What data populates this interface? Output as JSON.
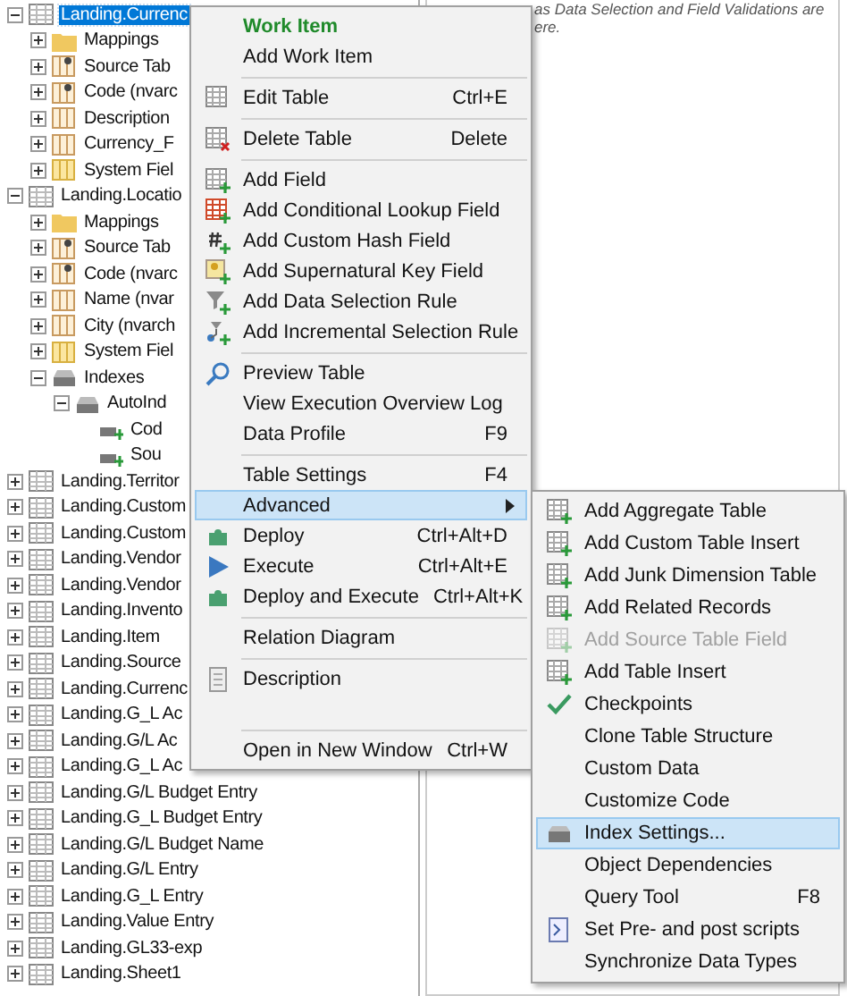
{
  "tree": {
    "items": [
      {
        "label": "Landing.Currenc",
        "kind": "table",
        "expanded": true,
        "selected": true,
        "children": [
          {
            "label": "Mappings",
            "kind": "folder",
            "expanded": false,
            "selected": false
          },
          {
            "label": "Source Tab",
            "kind": "key-field",
            "expanded": false,
            "selected": false
          },
          {
            "label": "Code (nvarc",
            "kind": "key-field",
            "expanded": false,
            "selected": false
          },
          {
            "label": "Description",
            "kind": "field",
            "expanded": false,
            "selected": false
          },
          {
            "label": "Currency_F",
            "kind": "field",
            "expanded": false,
            "selected": false
          },
          {
            "label": "System Fiel",
            "kind": "system-field",
            "expanded": false,
            "selected": false
          }
        ]
      },
      {
        "label": "Landing.Locatio",
        "kind": "table",
        "expanded": true,
        "selected": false,
        "children": [
          {
            "label": "Mappings",
            "kind": "folder",
            "expanded": false,
            "selected": false
          },
          {
            "label": "Source Tab",
            "kind": "key-field",
            "expanded": false,
            "selected": false
          },
          {
            "label": "Code (nvarc",
            "kind": "key-field",
            "expanded": false,
            "selected": false
          },
          {
            "label": "Name (nvar",
            "kind": "field",
            "expanded": false,
            "selected": false
          },
          {
            "label": "City (nvarch",
            "kind": "field",
            "expanded": false,
            "selected": false
          },
          {
            "label": "System Fiel",
            "kind": "system-field",
            "expanded": false,
            "selected": false
          },
          {
            "label": "Indexes",
            "kind": "indexes",
            "expanded": true,
            "selected": false,
            "children": [
              {
                "label": "AutoInd",
                "kind": "indexes",
                "expanded": true,
                "selected": false,
                "children": [
                  {
                    "label": "Cod",
                    "kind": "index",
                    "selected": false
                  },
                  {
                    "label": "Sou",
                    "kind": "index",
                    "selected": false
                  }
                ]
              }
            ]
          }
        ]
      },
      {
        "label": "Landing.Territor",
        "kind": "table",
        "expanded": false,
        "selected": false
      },
      {
        "label": "Landing.Custom",
        "kind": "table",
        "expanded": false,
        "selected": false
      },
      {
        "label": "Landing.Custom",
        "kind": "table",
        "expanded": false,
        "selected": false
      },
      {
        "label": "Landing.Vendor",
        "kind": "table",
        "expanded": false,
        "selected": false
      },
      {
        "label": "Landing.Vendor",
        "kind": "table",
        "expanded": false,
        "selected": false
      },
      {
        "label": "Landing.Invento",
        "kind": "table",
        "expanded": false,
        "selected": false
      },
      {
        "label": "Landing.Item",
        "kind": "table",
        "expanded": false,
        "selected": false
      },
      {
        "label": "Landing.Source",
        "kind": "table",
        "expanded": false,
        "selected": false
      },
      {
        "label": "Landing.Currenc",
        "kind": "table",
        "expanded": false,
        "selected": false
      },
      {
        "label": "Landing.G_L Ac",
        "kind": "table",
        "expanded": false,
        "selected": false
      },
      {
        "label": "Landing.G/L Ac",
        "kind": "table",
        "expanded": false,
        "selected": false
      },
      {
        "label": "Landing.G_L Ac",
        "kind": "table",
        "expanded": false,
        "selected": false
      },
      {
        "label": "Landing.G/L Budget Entry",
        "kind": "table",
        "expanded": false,
        "selected": false
      },
      {
        "label": "Landing.G_L Budget Entry",
        "kind": "table",
        "expanded": false,
        "selected": false
      },
      {
        "label": "Landing.G/L Budget Name",
        "kind": "table",
        "expanded": false,
        "selected": false
      },
      {
        "label": "Landing.G/L Entry",
        "kind": "table",
        "expanded": false,
        "selected": false
      },
      {
        "label": "Landing.G_L Entry",
        "kind": "table",
        "expanded": false,
        "selected": false
      },
      {
        "label": "Landing.Value Entry",
        "kind": "table",
        "expanded": false,
        "selected": false
      },
      {
        "label": "Landing.GL33-exp",
        "kind": "table",
        "expanded": false,
        "selected": false
      },
      {
        "label": "Landing.Sheet1",
        "kind": "table",
        "expanded": false,
        "selected": false
      }
    ]
  },
  "description_panel": {
    "lines": [
      "as Data Selection and Field Validations are",
      "ere."
    ]
  },
  "context_menu": {
    "items": [
      {
        "kind": "header",
        "label": "Work Item"
      },
      {
        "kind": "item",
        "label": "Add Work Item",
        "selected": false
      },
      {
        "kind": "separator"
      },
      {
        "kind": "item",
        "label": "Edit Table",
        "shortcut": "Ctrl+E",
        "selected": false
      },
      {
        "kind": "separator"
      },
      {
        "kind": "item",
        "label": "Delete Table",
        "shortcut": "Delete",
        "selected": false
      },
      {
        "kind": "separator"
      },
      {
        "kind": "item",
        "label": "Add Field",
        "selected": false
      },
      {
        "kind": "item",
        "label": "Add Conditional Lookup Field",
        "selected": false
      },
      {
        "kind": "item",
        "label": "Add Custom Hash Field",
        "selected": false
      },
      {
        "kind": "item",
        "label": "Add Supernatural Key Field",
        "selected": false
      },
      {
        "kind": "item",
        "label": "Add Data Selection Rule",
        "selected": false
      },
      {
        "kind": "item",
        "label": "Add Incremental Selection Rule",
        "selected": false
      },
      {
        "kind": "separator"
      },
      {
        "kind": "item",
        "label": "Preview Table",
        "selected": false
      },
      {
        "kind": "item",
        "label": "View Execution Overview Log",
        "selected": false
      },
      {
        "kind": "item",
        "label": "Data Profile",
        "shortcut": "F9",
        "selected": false
      },
      {
        "kind": "separator"
      },
      {
        "kind": "item",
        "label": "Table Settings",
        "shortcut": "F4",
        "selected": false
      },
      {
        "kind": "item",
        "label": "Advanced",
        "submenu": true,
        "selected": true
      },
      {
        "kind": "item",
        "label": "Deploy",
        "shortcut": "Ctrl+Alt+D",
        "selected": false
      },
      {
        "kind": "item",
        "label": "Execute",
        "shortcut": "Ctrl+Alt+E",
        "selected": false
      },
      {
        "kind": "item",
        "label": "Deploy and Execute",
        "shortcut": "Ctrl+Alt+K",
        "selected": false
      },
      {
        "kind": "separator"
      },
      {
        "kind": "item",
        "label": "Relation Diagram",
        "selected": false
      },
      {
        "kind": "separator"
      },
      {
        "kind": "item",
        "label": "Description",
        "selected": false
      },
      {
        "kind": "spacer"
      },
      {
        "kind": "separator"
      },
      {
        "kind": "item",
        "label": "Open in New Window",
        "shortcut": "Ctrl+W",
        "selected": false
      }
    ]
  },
  "submenu": {
    "items": [
      {
        "label": "Add Aggregate Table",
        "selected": false,
        "disabled": false
      },
      {
        "label": "Add Custom Table Insert",
        "selected": false,
        "disabled": false
      },
      {
        "label": "Add Junk Dimension Table",
        "selected": false,
        "disabled": false
      },
      {
        "label": "Add Related Records",
        "selected": false,
        "disabled": false
      },
      {
        "label": "Add Source Table Field",
        "selected": false,
        "disabled": true
      },
      {
        "label": "Add Table Insert",
        "selected": false,
        "disabled": false
      },
      {
        "label": "Checkpoints",
        "selected": false,
        "disabled": false
      },
      {
        "label": "Clone Table Structure",
        "selected": false,
        "disabled": false
      },
      {
        "label": "Custom Data",
        "selected": false,
        "disabled": false
      },
      {
        "label": "Customize Code",
        "selected": false,
        "disabled": false
      },
      {
        "label": "Index Settings...",
        "selected": true,
        "disabled": false
      },
      {
        "label": "Object Dependencies",
        "selected": false,
        "disabled": false
      },
      {
        "label": "Query Tool",
        "shortcut": "F8",
        "selected": false,
        "disabled": false
      },
      {
        "label": "Set Pre- and post scripts",
        "selected": false,
        "disabled": false
      },
      {
        "label": "Synchronize Data Types",
        "selected": false,
        "disabled": false
      }
    ]
  }
}
